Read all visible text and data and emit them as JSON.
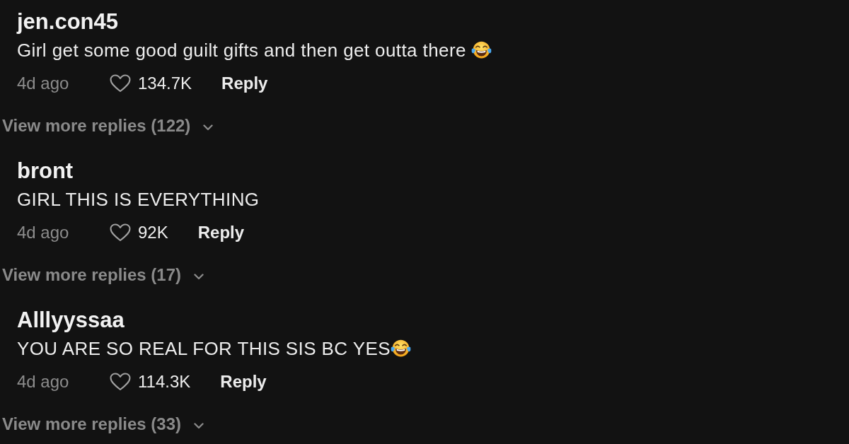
{
  "comments": [
    {
      "username": "jen.con45",
      "text": "Girl get some good guilt gifts and then get outta there ",
      "ends_with_emoji": true,
      "time": "4d ago",
      "liked": false,
      "likes": "134.7K",
      "reply_label": "Reply",
      "view_replies": "View more replies (122)"
    },
    {
      "username": "bront",
      "text": "GIRL THIS IS EVERYTHING",
      "ends_with_emoji": false,
      "time": "4d ago",
      "liked": false,
      "likes": "92K",
      "reply_label": "Reply",
      "view_replies": "View more replies (17)"
    },
    {
      "username": "Alllyyssaa",
      "text": "YOU ARE SO REAL FOR THIS SIS BC YES",
      "ends_with_emoji": true,
      "time": "4d ago",
      "liked": false,
      "likes": "114.3K",
      "reply_label": "Reply",
      "view_replies": "View more replies (33)"
    }
  ]
}
